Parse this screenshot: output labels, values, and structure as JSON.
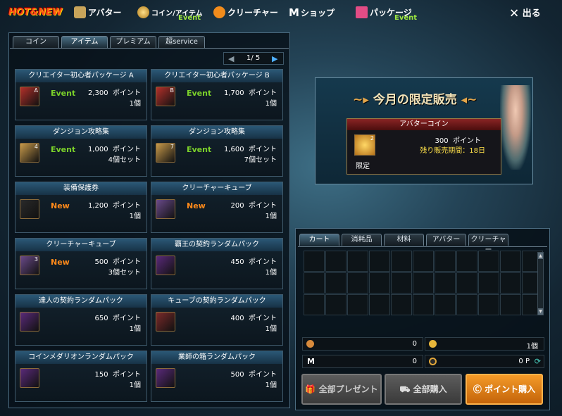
{
  "topbar": {
    "logo": "HOT&NEW",
    "items": [
      {
        "label": "アバター",
        "event": ""
      },
      {
        "label": "コイン/アイテム",
        "event": "Event"
      },
      {
        "label": "クリーチャー",
        "event": ""
      },
      {
        "label": "ショップ",
        "event": ""
      },
      {
        "label": "パッケージ",
        "event": "Event"
      }
    ],
    "shop_prefix": "M",
    "exit_label": "出る",
    "exit_glyph": "✕"
  },
  "category_tabs": [
    "コイン",
    "アイテム",
    "プレミアム",
    "超service"
  ],
  "active_tab": "アイテム",
  "pager": {
    "current": 1,
    "total": 5,
    "text": "1/ 5",
    "prev": "◀",
    "next": "▶"
  },
  "items": [
    {
      "title": "クリエイター初心者パッケージ A",
      "tag": "Event",
      "price": "2,300",
      "unit": "ポイント",
      "qty": "1個",
      "icon": "creator-package-a-icon",
      "icon_letter": "A"
    },
    {
      "title": "クリエイター初心者パッケージ B",
      "tag": "Event",
      "price": "1,700",
      "unit": "ポイント",
      "qty": "1個",
      "icon": "creator-package-b-icon",
      "icon_letter": "B"
    },
    {
      "title": "ダンジョン攻略集",
      "tag": "Event",
      "price": "1,000",
      "unit": "ポイント",
      "qty": "4個セット",
      "icon": "dungeon-guide-icon",
      "icon_letter": "4"
    },
    {
      "title": "ダンジョン攻略集",
      "tag": "Event",
      "price": "1,600",
      "unit": "ポイント",
      "qty": "7個セット",
      "icon": "dungeon-guide-icon",
      "icon_letter": "7"
    },
    {
      "title": "装備保護券",
      "tag": "New",
      "price": "1,200",
      "unit": "ポイント",
      "qty": "1個",
      "icon": "equipment-protection-ticket-icon",
      "icon_letter": ""
    },
    {
      "title": "クリーチャーキューブ",
      "tag": "New",
      "price": "200",
      "unit": "ポイント",
      "qty": "1個",
      "icon": "creature-cube-icon",
      "icon_letter": ""
    },
    {
      "title": "クリーチャーキューブ",
      "tag": "New",
      "price": "500",
      "unit": "ポイント",
      "qty": "3個セット",
      "icon": "creature-cube-icon",
      "icon_letter": "3"
    },
    {
      "title": "覇王の契約ランダムパック",
      "tag": "",
      "price": "450",
      "unit": "ポイント",
      "qty": "1個",
      "icon": "overlord-contract-pack-icon",
      "icon_letter": ""
    },
    {
      "title": "達人の契約ランダムパック",
      "tag": "",
      "price": "650",
      "unit": "ポイント",
      "qty": "1個",
      "icon": "master-contract-pack-icon",
      "icon_letter": ""
    },
    {
      "title": "キューブの契約ランダムパック",
      "tag": "",
      "price": "400",
      "unit": "ポイント",
      "qty": "1個",
      "icon": "cube-contract-pack-icon",
      "icon_letter": ""
    },
    {
      "title": "コインメダリオンランダムパック",
      "tag": "",
      "price": "150",
      "unit": "ポイント",
      "qty": "1個",
      "icon": "coin-medallion-pack-icon",
      "icon_letter": ""
    },
    {
      "title": "業師の箱ランダムパック",
      "tag": "",
      "price": "500",
      "unit": "ポイント",
      "qty": "1個",
      "icon": "craftsman-box-pack-icon",
      "icon_letter": ""
    }
  ],
  "promo": {
    "title": "今月の限定販売",
    "item_name": "アバターコイン",
    "price": "300",
    "unit": "ポイント",
    "remaining": "残り販売期間：18日",
    "limited_label": "限定",
    "icon_letter": "2"
  },
  "cart": {
    "tabs": [
      "カート",
      "消耗品",
      "材料",
      "アバター",
      "クリーチャー"
    ],
    "active_tab": "カート",
    "scroll_up": "▲",
    "scroll_down": "▼",
    "balances": [
      "0",
      "1個",
      "0",
      "0 P"
    ]
  },
  "buttons": {
    "gift_all": "全部プレゼント",
    "buy_all": "全部購入",
    "buy_points": "ポイント購入"
  },
  "colors": {
    "event_tag": "#7bd12a",
    "new_tag": "#ff8a1a",
    "orange_button": "#e27d0e"
  }
}
